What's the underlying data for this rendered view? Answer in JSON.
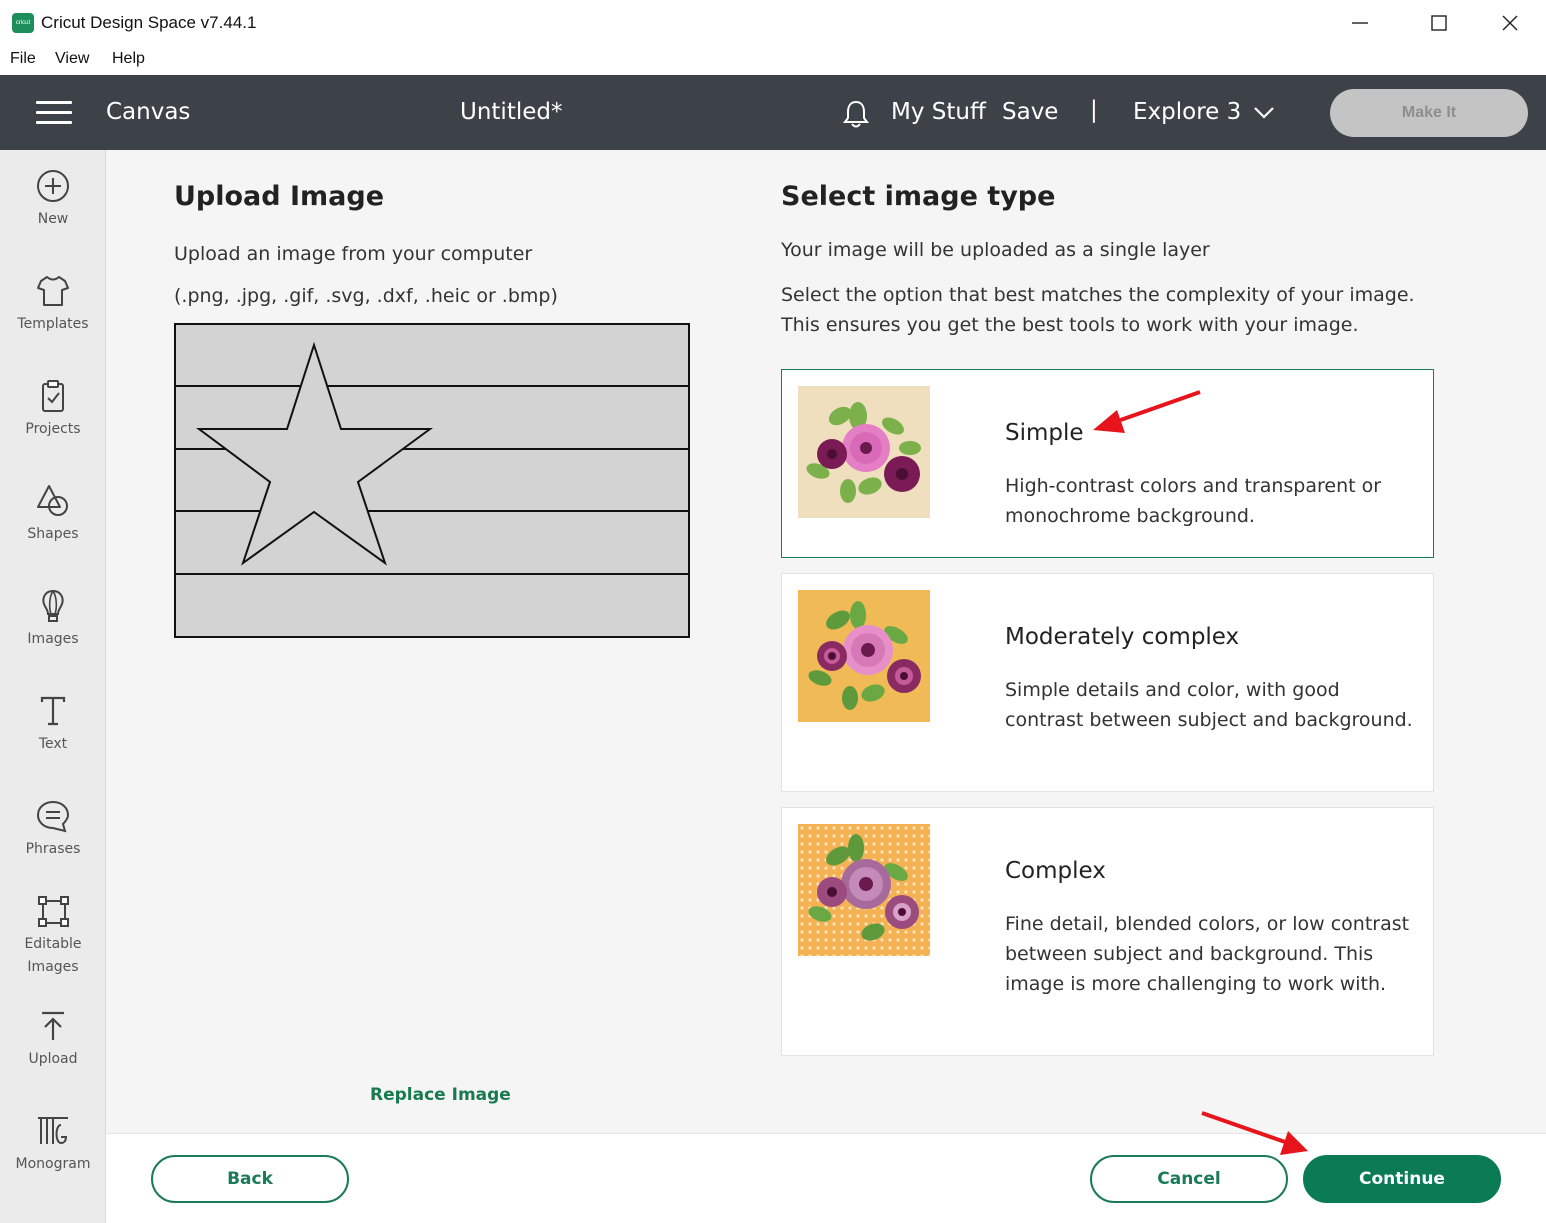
{
  "window": {
    "logo_text": "cricut",
    "title": "Cricut Design Space  v7.44.1"
  },
  "menu": [
    "File",
    "View",
    "Help"
  ],
  "header": {
    "canvas_label": "Canvas",
    "doc_title": "Untitled*",
    "my_stuff": "My Stuff",
    "save": "Save",
    "divider": "|",
    "machine": "Explore 3",
    "make_it": "Make It"
  },
  "sidebar": {
    "items": [
      {
        "label": "New",
        "icon": "plus-circle-icon"
      },
      {
        "label": "Templates",
        "icon": "tshirt-icon"
      },
      {
        "label": "Projects",
        "icon": "clipboard-icon"
      },
      {
        "label": "Shapes",
        "icon": "shapes-icon"
      },
      {
        "label": "Images",
        "icon": "lightbulb-icon"
      },
      {
        "label": "Text",
        "icon": "text-icon"
      },
      {
        "label": "Phrases",
        "icon": "speech-bubble-icon"
      },
      {
        "label": "Editable Images",
        "label_line1": "Editable",
        "label_line2": "Images",
        "icon": "edit-nodes-icon"
      },
      {
        "label": "Upload",
        "icon": "upload-icon"
      },
      {
        "label": "Monogram",
        "icon": "monogram-icon"
      }
    ]
  },
  "upload": {
    "title": "Upload Image",
    "subtitle": "Upload an image from your computer",
    "formats": "(.png, .jpg, .gif, .svg, .dxf, .heic or .bmp)",
    "replace_link": "Replace Image"
  },
  "select": {
    "title": "Select image type",
    "line1": "Your image will be uploaded as a single layer",
    "line2": "Select the option that best matches the complexity of your image.",
    "line3": "This ensures you get the best tools to work with your image.",
    "options": [
      {
        "title": "Simple",
        "desc": "High-contrast colors and transparent or monochrome background.",
        "selected": true,
        "thumb_bg": "#f0dfbf"
      },
      {
        "title": "Moderately complex",
        "desc": "Simple details and color, with good contrast between subject and background.",
        "selected": false,
        "thumb_bg": "#f0bb56"
      },
      {
        "title": "Complex",
        "desc": "Fine detail, blended colors, or low contrast between subject and background. This image is more challenging to work with.",
        "selected": false,
        "thumb_bg": "#f4b255"
      }
    ]
  },
  "footer": {
    "back": "Back",
    "cancel": "Cancel",
    "continue": "Continue"
  },
  "colors": {
    "header_bg": "#3d4248",
    "accent_green": "#0a7b55",
    "annotation_red": "#e8141b"
  }
}
